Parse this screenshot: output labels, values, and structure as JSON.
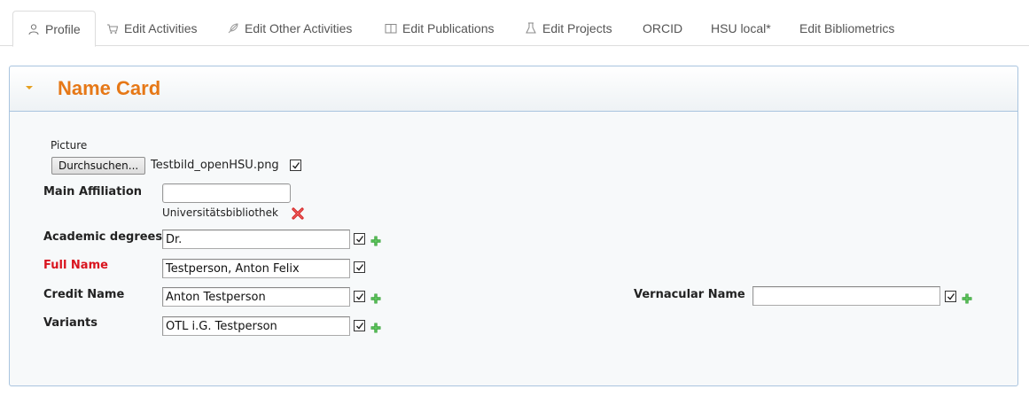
{
  "tabs": [
    {
      "label": "Profile",
      "icon": "person-icon",
      "active": true
    },
    {
      "label": "Edit Activities",
      "icon": "cart-icon"
    },
    {
      "label": "Edit Other Activities",
      "icon": "feather-icon"
    },
    {
      "label": "Edit Publications",
      "icon": "book-icon"
    },
    {
      "label": "Edit Projects",
      "icon": "flask-icon"
    },
    {
      "label": "ORCID"
    },
    {
      "label": "HSU local*"
    },
    {
      "label": "Edit Bibliometrics"
    }
  ],
  "panel": {
    "title": "Name Card"
  },
  "form": {
    "picture": {
      "label": "Picture",
      "browse_label": "Durchsuchen...",
      "filename": "Testbild_openHSU.png",
      "checked": true
    },
    "main_affiliation": {
      "label": "Main Affiliation",
      "value": "",
      "selected": "Universitätsbibliothek"
    },
    "academic_degrees": {
      "label": "Academic degrees",
      "value": "Dr.",
      "checked": true
    },
    "full_name": {
      "label": "Full Name",
      "value": "Testperson, Anton Felix",
      "checked": true,
      "required_color": "#d9141e"
    },
    "credit_name": {
      "label": "Credit Name",
      "value": "Anton Testperson",
      "checked": true
    },
    "variants": {
      "label": "Variants",
      "value": "OTL i.G. Testperson",
      "checked": true
    },
    "vernacular_name": {
      "label": "Vernacular Name",
      "value": "",
      "checked": true
    }
  },
  "colors": {
    "accent_title": "#e67817",
    "panel_border": "#a9c4df",
    "required": "#d9141e",
    "add_green": "#3aa33a",
    "remove_red": "#d42424"
  }
}
